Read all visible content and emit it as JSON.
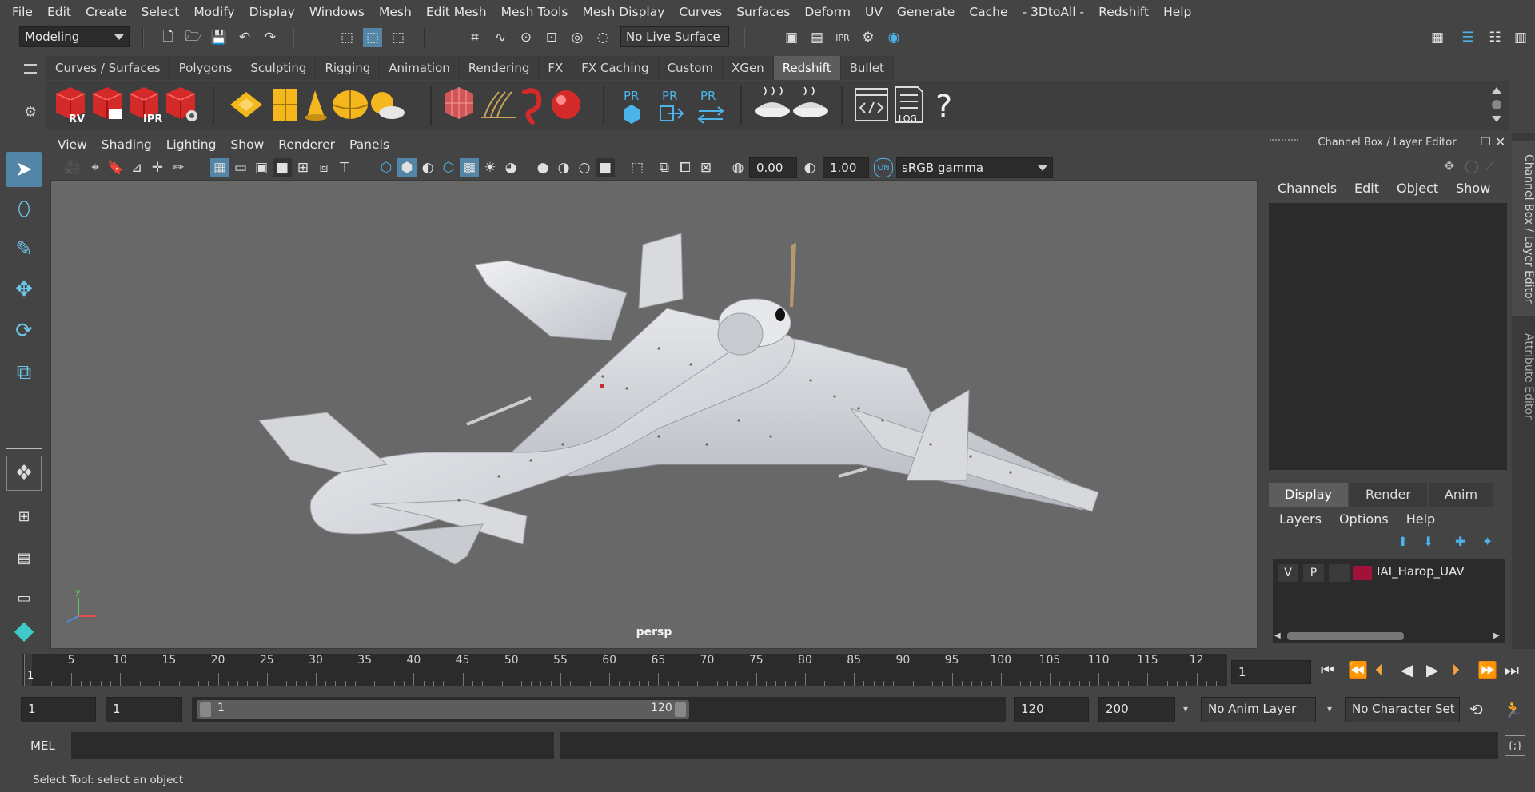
{
  "menubar": {
    "items": [
      "File",
      "Edit",
      "Create",
      "Select",
      "Modify",
      "Display",
      "Windows",
      "Mesh",
      "Edit Mesh",
      "Mesh Tools",
      "Mesh Display",
      "Curves",
      "Surfaces",
      "Deform",
      "UV",
      "Generate",
      "Cache",
      "- 3DtoAll -",
      "Redshift",
      "Help"
    ]
  },
  "statusline": {
    "mode": "Modeling",
    "live_surface": "No Live Surface"
  },
  "shelf": {
    "tabs": [
      "Curves / Surfaces",
      "Polygons",
      "Sculpting",
      "Rigging",
      "Animation",
      "Rendering",
      "FX",
      "FX Caching",
      "Custom",
      "XGen",
      "Redshift",
      "Bullet"
    ],
    "active_tab": "Redshift",
    "icons": {
      "rv_label": "RV",
      "ipr_label": "IPR",
      "pr_label": "PR",
      "log_label": "LOG",
      "help_glyph": "?"
    }
  },
  "viewport": {
    "menu": [
      "View",
      "Shading",
      "Lighting",
      "Show",
      "Renderer",
      "Panels"
    ],
    "exposure": "0.00",
    "gamma": "1.00",
    "color_space": "sRGB gamma",
    "camera_label": "persp",
    "axis_y": "y"
  },
  "channelbox": {
    "title": "Channel Box / Layer Editor",
    "menu": [
      "Channels",
      "Edit",
      "Object",
      "Show"
    ],
    "side_tabs": [
      "Channel Box / Layer Editor",
      "Attribute Editor"
    ]
  },
  "layer_editor": {
    "tabs": [
      "Display",
      "Render",
      "Anim"
    ],
    "active_tab": "Display",
    "menu": [
      "Layers",
      "Options",
      "Help"
    ],
    "layers": [
      {
        "v": "V",
        "p": "P",
        "name": "IAI_Harop_UAV",
        "color": "#a0123a"
      }
    ]
  },
  "timeline": {
    "ticks": [
      "5",
      "10",
      "15",
      "20",
      "25",
      "30",
      "35",
      "40",
      "45",
      "50",
      "55",
      "60",
      "65",
      "70",
      "75",
      "80",
      "85",
      "90",
      "95",
      "100",
      "105",
      "110",
      "115",
      "12"
    ],
    "current_frame_marker": "1",
    "current_frame": "1"
  },
  "range": {
    "start": "1",
    "playback_start": "1",
    "slider_start": "1",
    "slider_end": "120",
    "playback_end": "120",
    "end": "200",
    "anim_layer": "No Anim Layer",
    "character_set": "No Character Set"
  },
  "commandline": {
    "label": "MEL"
  },
  "helpline": {
    "text": "Select Tool: select an object"
  },
  "colors": {
    "accent": "#5285a6",
    "icon_blue": "#4cb4ea",
    "redshift_red": "#d42a2a",
    "shelf_yellow": "#f4b71e"
  }
}
